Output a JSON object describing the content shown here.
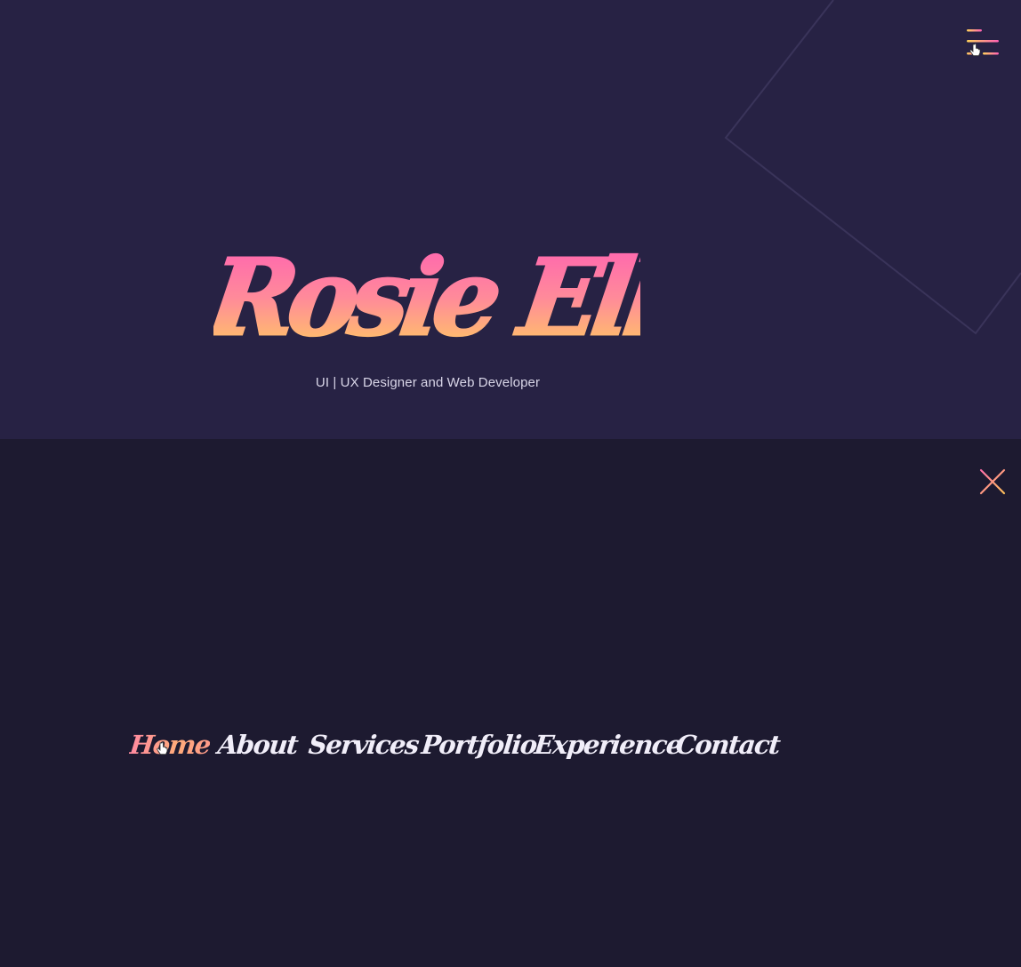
{
  "hero": {
    "name": "Rosie Ellis",
    "subtitle": "UI | UX Designer and Web Developer",
    "name_gradient": [
      "#ff5fb4",
      "#ff8a9a",
      "#ffd25a"
    ]
  },
  "header": {
    "menu_icon": "hamburger-menu-icon"
  },
  "menu": {
    "close_icon": "close-icon",
    "items": [
      {
        "label": "Home",
        "active": true
      },
      {
        "label": "About",
        "active": false
      },
      {
        "label": "Services",
        "active": false
      },
      {
        "label": "Portfolio",
        "active": false
      },
      {
        "label": "Experience",
        "active": false
      },
      {
        "label": "Contact",
        "active": false
      }
    ]
  },
  "colors": {
    "hero_background": "#272244",
    "menu_background": "#1d1a30",
    "accent_pink": "#ff5fb4",
    "accent_yellow": "#ffd25a",
    "nav_text": "#f1eef9"
  }
}
